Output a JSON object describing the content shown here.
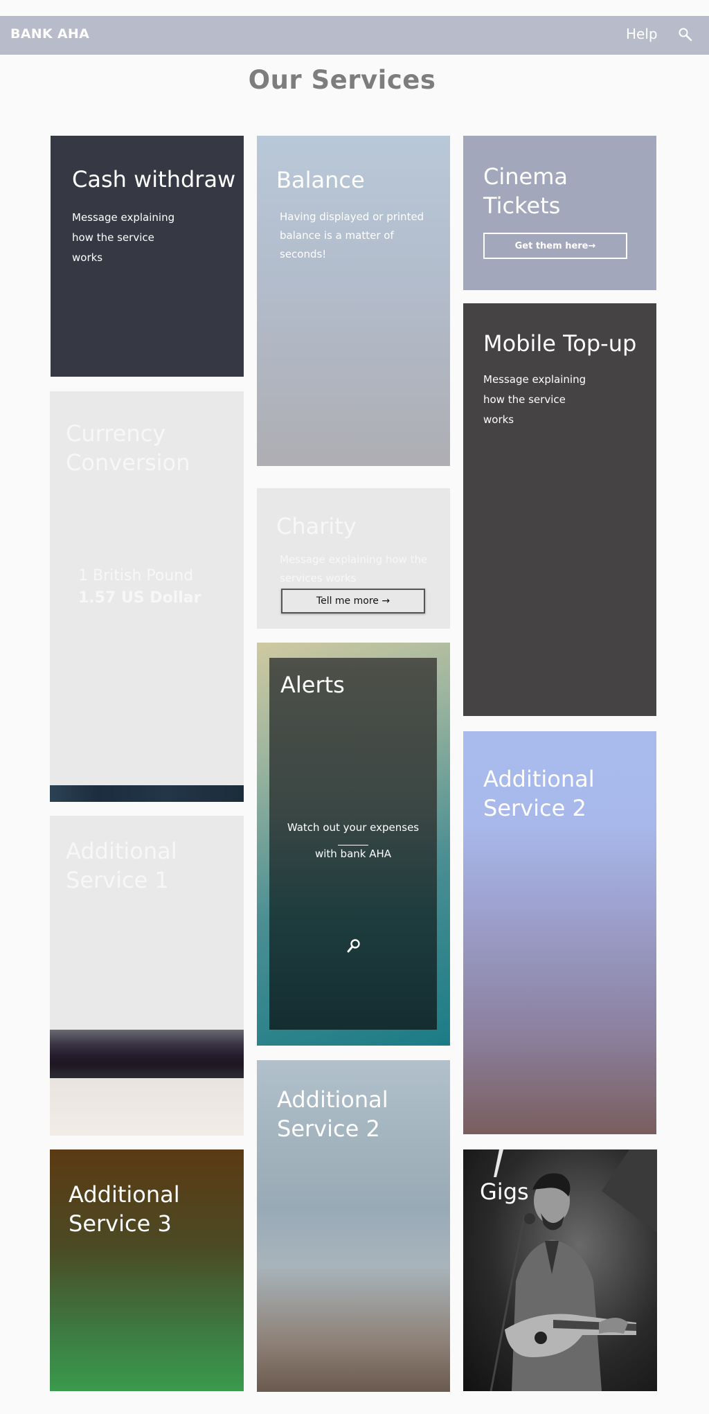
{
  "header": {
    "brand": "BANK AHA",
    "help_label": "Help",
    "search_icon": "search-icon"
  },
  "page_title": "Our Services",
  "tiles": {
    "cash": {
      "title": "Cash withdraw",
      "text": "Message explaining\nhow the service\nworks",
      "color": "#363943"
    },
    "balance": {
      "title": "Balance",
      "text": "Having displayed or printed\nbalance is a matter of\nseconds!"
    },
    "cinema": {
      "title": "Cinema\nTickets",
      "button_label": "Get them here→",
      "color": "#a3a7bb"
    },
    "mobile": {
      "title": "Mobile Top-up",
      "text": "Message explaining\nhow the service\nworks",
      "color": "#464344"
    },
    "currency": {
      "title": "Currency\nConversion",
      "from_amount": "1 British Pound",
      "to_amount": "1.57 US Dollar"
    },
    "charity": {
      "title": "Charity",
      "text": "Message explaining how the\nservices works",
      "button_label": "Tell me more →"
    },
    "alerts": {
      "title": "Alerts",
      "line1": "Watch out your expenses",
      "line2": "with bank AHA",
      "icon": "search-icon"
    },
    "additional1": {
      "title": "Additional\nService 1"
    },
    "additional2_right": {
      "title": "Additional\nService 2"
    },
    "additional2_mid": {
      "title": "Additional\nService 2"
    },
    "additional3": {
      "title": "Additional\nService 3"
    },
    "gigs": {
      "title": "Gigs"
    }
  }
}
